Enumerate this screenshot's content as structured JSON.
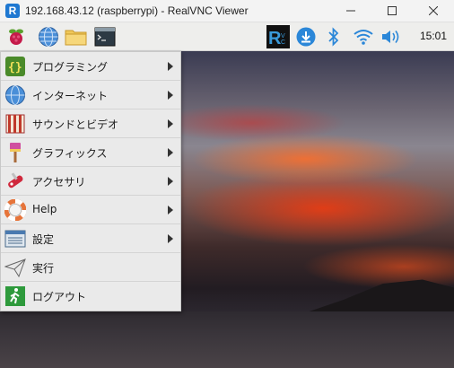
{
  "window": {
    "title": "192.168.43.12 (raspberrypi) - RealVNC Viewer",
    "app_icon_letter": "R"
  },
  "panel": {
    "launchers": [
      "raspberry-menu",
      "browser",
      "file-manager",
      "terminal"
    ],
    "tray": [
      "realvnc",
      "updates",
      "bluetooth",
      "wifi",
      "volume"
    ],
    "clock": "15:01"
  },
  "menu": {
    "items": [
      {
        "label": "プログラミング",
        "icon": "programming-icon",
        "submenu": true
      },
      {
        "label": "インターネット",
        "icon": "globe-icon",
        "submenu": true
      },
      {
        "label": "サウンドとビデオ",
        "icon": "sound-video-icon",
        "submenu": true
      },
      {
        "label": "グラフィックス",
        "icon": "graphics-icon",
        "submenu": true
      },
      {
        "label": "アクセサリ",
        "icon": "accessories-icon",
        "submenu": true
      },
      {
        "label": "Help",
        "icon": "help-icon",
        "submenu": true
      },
      {
        "label": "設定",
        "icon": "settings-icon",
        "submenu": true
      },
      {
        "label": "実行",
        "icon": "run-icon",
        "submenu": false
      },
      {
        "label": "ログアウト",
        "icon": "logout-icon",
        "submenu": false
      }
    ]
  },
  "colors": {
    "panel_bg": "#eeeeec",
    "menu_bg": "#eaeaea",
    "accent_blue": "#1f78d1"
  }
}
